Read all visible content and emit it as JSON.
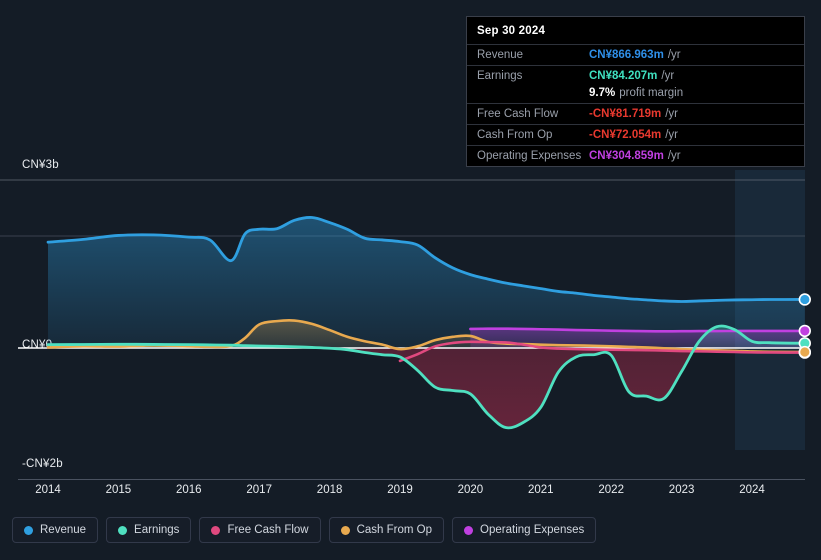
{
  "yaxis": {
    "top_label": "CN¥3b",
    "zero_label": "CN¥0",
    "bottom_label": "-CN¥2b"
  },
  "tooltip": {
    "title": "Sep 30 2024",
    "rows": [
      {
        "label": "Revenue",
        "value": "CN¥866.963m",
        "unit": "/yr",
        "color": "#2f8fe8"
      },
      {
        "label": "Earnings",
        "value": "CN¥84.207m",
        "unit": "/yr",
        "color": "#3fe0c0"
      },
      {
        "label": "",
        "value": "9.7%",
        "unit": "profit margin",
        "sub": true
      },
      {
        "label": "Free Cash Flow",
        "value": "-CN¥81.719m",
        "unit": "/yr",
        "color": "#e8392f"
      },
      {
        "label": "Cash From Op",
        "value": "-CN¥72.054m",
        "unit": "/yr",
        "color": "#e8392f"
      },
      {
        "label": "Operating Expenses",
        "value": "CN¥304.859m",
        "unit": "/yr",
        "color": "#c040e0"
      }
    ]
  },
  "legend": [
    {
      "label": "Revenue",
      "color": "#2f9fe0",
      "icon": "dot-icon"
    },
    {
      "label": "Earnings",
      "color": "#4fe0c0",
      "icon": "dot-icon"
    },
    {
      "label": "Free Cash Flow",
      "color": "#e0497f",
      "icon": "dot-icon"
    },
    {
      "label": "Cash From Op",
      "color": "#e8a94f",
      "icon": "dot-icon"
    },
    {
      "label": "Operating Expenses",
      "color": "#c040e0",
      "icon": "dot-icon"
    }
  ],
  "chart_data": {
    "type": "area",
    "title": "",
    "xlabel": "",
    "ylabel": "",
    "currency": "CN¥",
    "ylim": [
      -2000,
      3000
    ],
    "yticks": [
      3000,
      0,
      -2000
    ],
    "ytick_labels": [
      "CN¥3b",
      "CN¥0",
      "-CN¥2b"
    ],
    "grid": true,
    "legend_position": "bottom-left",
    "units": "millions CN¥",
    "x": [
      2014,
      2014.5,
      2015,
      2015.5,
      2016,
      2016.3,
      2016.6,
      2016.8,
      2017,
      2017.25,
      2017.5,
      2017.75,
      2018,
      2018.25,
      2018.5,
      2018.75,
      2019,
      2019.25,
      2019.5,
      2019.75,
      2020,
      2020.25,
      2020.5,
      2020.75,
      2021,
      2021.25,
      2021.5,
      2021.75,
      2022,
      2022.25,
      2022.5,
      2022.75,
      2023,
      2023.25,
      2023.5,
      2023.75,
      2024,
      2024.25,
      2024.75
    ],
    "xticks": [
      2014,
      2015,
      2016,
      2017,
      2018,
      2019,
      2020,
      2021,
      2022,
      2023,
      2024
    ],
    "series": [
      {
        "name": "Revenue",
        "color": "#2f9fe0",
        "filled": true,
        "values": [
          1890,
          1940,
          2010,
          2020,
          1980,
          1930,
          1560,
          2040,
          2120,
          2130,
          2280,
          2330,
          2240,
          2120,
          1960,
          1930,
          1900,
          1840,
          1610,
          1430,
          1310,
          1230,
          1160,
          1110,
          1060,
          1010,
          980,
          940,
          910,
          880,
          860,
          840,
          830,
          840,
          850,
          858,
          862,
          866,
          866.963
        ]
      },
      {
        "name": "Earnings",
        "color": "#4fe0c0",
        "filled": true,
        "values": [
          60,
          62,
          66,
          64,
          60,
          55,
          50,
          42,
          35,
          30,
          22,
          10,
          -5,
          -30,
          -80,
          -120,
          -160,
          -400,
          -700,
          -760,
          -820,
          -1180,
          -1420,
          -1330,
          -1060,
          -430,
          -160,
          -120,
          -130,
          -780,
          -860,
          -900,
          -420,
          120,
          380,
          330,
          120,
          95,
          84.207
        ]
      },
      {
        "name": "Free Cash Flow",
        "color": "#e0497f",
        "filled": false,
        "start_x": 2018.8,
        "values": [
          null,
          null,
          null,
          null,
          null,
          null,
          null,
          null,
          null,
          null,
          null,
          null,
          null,
          null,
          null,
          null,
          -230,
          -110,
          30,
          90,
          110,
          105,
          100,
          60,
          10,
          -10,
          -20,
          -25,
          -30,
          -35,
          -40,
          -45,
          -55,
          -60,
          -65,
          -70,
          -78,
          -80,
          -81.719
        ]
      },
      {
        "name": "Cash From Op",
        "color": "#e8a94f",
        "filled": true,
        "values": [
          10,
          30,
          25,
          45,
          30,
          20,
          35,
          180,
          420,
          480,
          490,
          430,
          320,
          200,
          120,
          60,
          -20,
          30,
          140,
          200,
          215,
          110,
          80,
          70,
          60,
          50,
          45,
          40,
          30,
          20,
          10,
          -5,
          -20,
          -30,
          -40,
          -50,
          -62,
          -68,
          -72.054
        ]
      },
      {
        "name": "Operating Expenses",
        "color": "#c040e0",
        "filled": true,
        "start_x": 2019.9,
        "values": [
          null,
          null,
          null,
          null,
          null,
          null,
          null,
          null,
          null,
          null,
          null,
          null,
          null,
          null,
          null,
          null,
          null,
          null,
          null,
          null,
          340,
          345,
          345,
          340,
          335,
          330,
          320,
          315,
          310,
          305,
          300,
          298,
          300,
          302,
          303,
          304,
          304,
          304.5,
          304.859
        ]
      }
    ]
  }
}
